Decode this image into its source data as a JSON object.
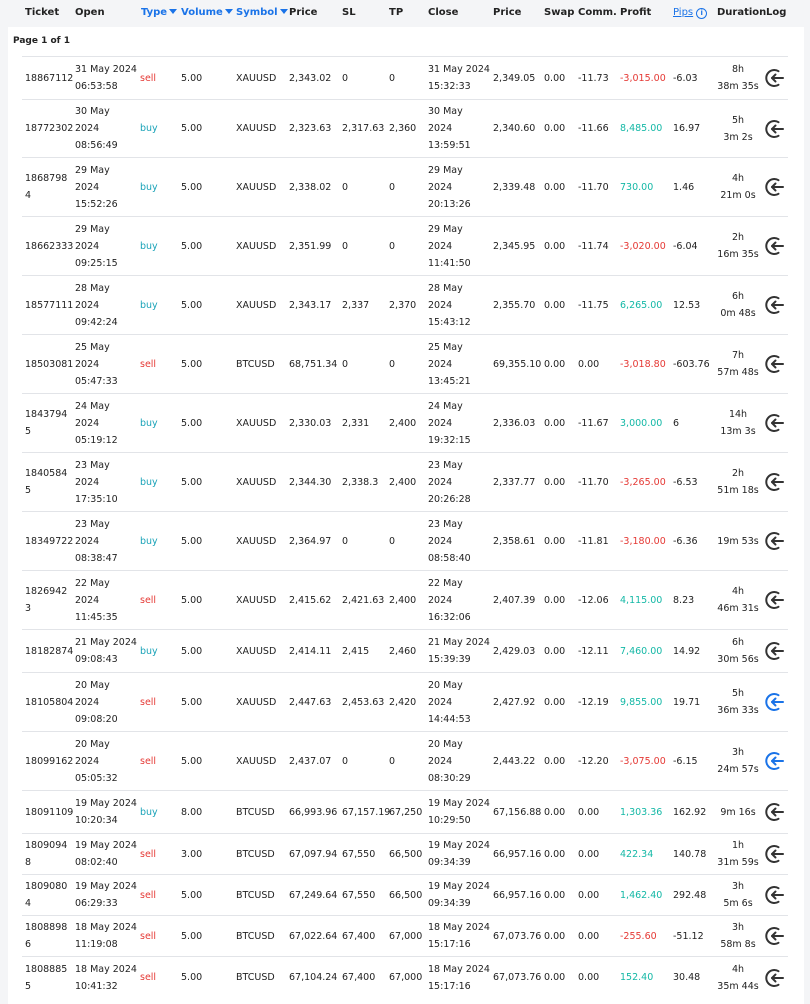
{
  "columns": {
    "ticket": "Ticket",
    "open": "Open",
    "type": "Type",
    "volume": "Volume",
    "symbol": "Symbol",
    "price": "Price",
    "sl": "SL",
    "tp": "TP",
    "close": "Close",
    "close_price": "Price",
    "swap": "Swap",
    "comm": "Comm.",
    "profit": "Profit",
    "pips": "Pips",
    "duration": "Duration",
    "log": "Log"
  },
  "page_info": "Page 1 of 1",
  "colors": {
    "sell": "#e53935",
    "buy": "#1aa3b8",
    "profit_pos": "#14b8a6",
    "profit_neg": "#e53935",
    "link": "#1a73e8"
  },
  "rows": [
    {
      "ticket": [
        "18867112"
      ],
      "open": [
        "31 May 2024",
        "06:53:58"
      ],
      "type": "sell",
      "volume": "5.00",
      "symbol": "XAUUSD",
      "price": "2,343.02",
      "sl": "0",
      "tp": "0",
      "close": [
        "31 May 2024",
        "15:32:33"
      ],
      "close_price": "2,349.05",
      "swap": "0.00",
      "comm": "-11.73",
      "profit": "-3,015.00",
      "pips": "-6.03",
      "duration": [
        "8h",
        "38m 35s"
      ],
      "log_active": false
    },
    {
      "ticket": [
        "18772302"
      ],
      "open": [
        "30 May",
        "2024",
        "08:56:49"
      ],
      "type": "buy",
      "volume": "5.00",
      "symbol": "XAUUSD",
      "price": "2,323.63",
      "sl": "2,317.63",
      "tp": "2,360",
      "close": [
        "30 May",
        "2024",
        "13:59:51"
      ],
      "close_price": "2,340.60",
      "swap": "0.00",
      "comm": "-11.66",
      "profit": "8,485.00",
      "pips": "16.97",
      "duration": [
        "5h",
        "3m 2s"
      ],
      "log_active": false
    },
    {
      "ticket": [
        "1868798",
        "4"
      ],
      "open": [
        "29 May",
        "2024",
        "15:52:26"
      ],
      "type": "buy",
      "volume": "5.00",
      "symbol": "XAUUSD",
      "price": "2,338.02",
      "sl": "0",
      "tp": "0",
      "close": [
        "29 May",
        "2024",
        "20:13:26"
      ],
      "close_price": "2,339.48",
      "swap": "0.00",
      "comm": "-11.70",
      "profit": "730.00",
      "pips": "1.46",
      "duration": [
        "4h",
        "21m 0s"
      ],
      "log_active": false
    },
    {
      "ticket": [
        "18662333"
      ],
      "open": [
        "29 May",
        "2024",
        "09:25:15"
      ],
      "type": "buy",
      "volume": "5.00",
      "symbol": "XAUUSD",
      "price": "2,351.99",
      "sl": "0",
      "tp": "0",
      "close": [
        "29 May",
        "2024",
        "11:41:50"
      ],
      "close_price": "2,345.95",
      "swap": "0.00",
      "comm": "-11.74",
      "profit": "-3,020.00",
      "pips": "-6.04",
      "duration": [
        "2h",
        "16m 35s"
      ],
      "log_active": false
    },
    {
      "ticket": [
        "18577111"
      ],
      "open": [
        "28 May",
        "2024",
        "09:42:24"
      ],
      "type": "buy",
      "volume": "5.00",
      "symbol": "XAUUSD",
      "price": "2,343.17",
      "sl": "2,337",
      "tp": "2,370",
      "close": [
        "28 May",
        "2024",
        "15:43:12"
      ],
      "close_price": "2,355.70",
      "swap": "0.00",
      "comm": "-11.75",
      "profit": "6,265.00",
      "pips": "12.53",
      "duration": [
        "6h",
        "0m 48s"
      ],
      "log_active": false
    },
    {
      "ticket": [
        "18503081"
      ],
      "open": [
        "25 May",
        "2024",
        "05:47:33"
      ],
      "type": "sell",
      "volume": "5.00",
      "symbol": "BTCUSD",
      "price": "68,751.34",
      "sl": "0",
      "tp": "0",
      "close": [
        "25 May",
        "2024",
        "13:45:21"
      ],
      "close_price": "69,355.10",
      "swap": "0.00",
      "comm": "0.00",
      "profit": "-3,018.80",
      "pips": "-603.76",
      "duration": [
        "7h",
        "57m 48s"
      ],
      "log_active": false
    },
    {
      "ticket": [
        "1843794",
        "5"
      ],
      "open": [
        "24 May",
        "2024",
        "05:19:12"
      ],
      "type": "buy",
      "volume": "5.00",
      "symbol": "XAUUSD",
      "price": "2,330.03",
      "sl": "2,331",
      "tp": "2,400",
      "close": [
        "24 May",
        "2024",
        "19:32:15"
      ],
      "close_price": "2,336.03",
      "swap": "0.00",
      "comm": "-11.67",
      "profit": "3,000.00",
      "pips": "6",
      "duration": [
        "14h",
        "13m 3s"
      ],
      "log_active": false
    },
    {
      "ticket": [
        "1840584",
        "5"
      ],
      "open": [
        "23 May",
        "2024",
        "17:35:10"
      ],
      "type": "buy",
      "volume": "5.00",
      "symbol": "XAUUSD",
      "price": "2,344.30",
      "sl": "2,338.3",
      "tp": "2,400",
      "close": [
        "23 May",
        "2024",
        "20:26:28"
      ],
      "close_price": "2,337.77",
      "swap": "0.00",
      "comm": "-11.70",
      "profit": "-3,265.00",
      "pips": "-6.53",
      "duration": [
        "2h",
        "51m 18s"
      ],
      "log_active": false
    },
    {
      "ticket": [
        "18349722"
      ],
      "open": [
        "23 May",
        "2024",
        "08:38:47"
      ],
      "type": "buy",
      "volume": "5.00",
      "symbol": "XAUUSD",
      "price": "2,364.97",
      "sl": "0",
      "tp": "0",
      "close": [
        "23 May",
        "2024",
        "08:58:40"
      ],
      "close_price": "2,358.61",
      "swap": "0.00",
      "comm": "-11.81",
      "profit": "-3,180.00",
      "pips": "-6.36",
      "duration": [
        "19m 53s"
      ],
      "log_active": false
    },
    {
      "ticket": [
        "1826942",
        "3"
      ],
      "open": [
        "22 May",
        "2024",
        "11:45:35"
      ],
      "type": "sell",
      "volume": "5.00",
      "symbol": "XAUUSD",
      "price": "2,415.62",
      "sl": "2,421.63",
      "tp": "2,400",
      "close": [
        "22 May",
        "2024",
        "16:32:06"
      ],
      "close_price": "2,407.39",
      "swap": "0.00",
      "comm": "-12.06",
      "profit": "4,115.00",
      "pips": "8.23",
      "duration": [
        "4h",
        "46m 31s"
      ],
      "log_active": false
    },
    {
      "ticket": [
        "18182874"
      ],
      "open": [
        "21 May 2024",
        "09:08:43"
      ],
      "type": "buy",
      "volume": "5.00",
      "symbol": "XAUUSD",
      "price": "2,414.11",
      "sl": "2,415",
      "tp": "2,460",
      "close": [
        "21 May 2024",
        "15:39:39"
      ],
      "close_price": "2,429.03",
      "swap": "0.00",
      "comm": "-12.11",
      "profit": "7,460.00",
      "pips": "14.92",
      "duration": [
        "6h",
        "30m 56s"
      ],
      "log_active": false
    },
    {
      "ticket": [
        "18105804"
      ],
      "open": [
        "20 May",
        "2024",
        "09:08:20"
      ],
      "type": "sell",
      "volume": "5.00",
      "symbol": "XAUUSD",
      "price": "2,447.63",
      "sl": "2,453.63",
      "tp": "2,420",
      "close": [
        "20 May",
        "2024",
        "14:44:53"
      ],
      "close_price": "2,427.92",
      "swap": "0.00",
      "comm": "-12.19",
      "profit": "9,855.00",
      "pips": "19.71",
      "duration": [
        "5h",
        "36m 33s"
      ],
      "log_active": true
    },
    {
      "ticket": [
        "18099162"
      ],
      "open": [
        "20 May",
        "2024",
        "05:05:32"
      ],
      "type": "sell",
      "volume": "5.00",
      "symbol": "XAUUSD",
      "price": "2,437.07",
      "sl": "0",
      "tp": "0",
      "close": [
        "20 May",
        "2024",
        "08:30:29"
      ],
      "close_price": "2,443.22",
      "swap": "0.00",
      "comm": "-12.20",
      "profit": "-3,075.00",
      "pips": "-6.15",
      "duration": [
        "3h",
        "24m 57s"
      ],
      "log_active": true
    },
    {
      "ticket": [
        "18091109"
      ],
      "open": [
        "19 May 2024",
        "10:20:34"
      ],
      "type": "buy",
      "volume": "8.00",
      "symbol": "BTCUSD",
      "price": "66,993.96",
      "sl": "67,157.19",
      "tp": "67,250",
      "close": [
        "19 May 2024",
        "10:29:50"
      ],
      "close_price": "67,156.88",
      "swap": "0.00",
      "comm": "0.00",
      "profit": "1,303.36",
      "pips": "162.92",
      "duration": [
        "9m 16s"
      ],
      "log_active": false
    },
    {
      "ticket": [
        "1809094",
        "8"
      ],
      "open": [
        "19 May 2024",
        "08:02:40"
      ],
      "type": "sell",
      "volume": "3.00",
      "symbol": "BTCUSD",
      "price": "67,097.94",
      "sl": "67,550",
      "tp": "66,500",
      "close": [
        "19 May 2024",
        "09:34:39"
      ],
      "close_price": "66,957.16",
      "swap": "0.00",
      "comm": "0.00",
      "profit": "422.34",
      "pips": "140.78",
      "duration": [
        "1h",
        "31m 59s"
      ],
      "log_active": false
    },
    {
      "ticket": [
        "1809080",
        "4"
      ],
      "open": [
        "19 May 2024",
        "06:29:33"
      ],
      "type": "sell",
      "volume": "5.00",
      "symbol": "BTCUSD",
      "price": "67,249.64",
      "sl": "67,550",
      "tp": "66,500",
      "close": [
        "19 May 2024",
        "09:34:39"
      ],
      "close_price": "66,957.16",
      "swap": "0.00",
      "comm": "0.00",
      "profit": "1,462.40",
      "pips": "292.48",
      "duration": [
        "3h",
        "5m 6s"
      ],
      "log_active": false
    },
    {
      "ticket": [
        "1808898",
        "6"
      ],
      "open": [
        "18 May 2024",
        "11:19:08"
      ],
      "type": "sell",
      "volume": "5.00",
      "symbol": "BTCUSD",
      "price": "67,022.64",
      "sl": "67,400",
      "tp": "67,000",
      "close": [
        "18 May 2024",
        "15:17:16"
      ],
      "close_price": "67,073.76",
      "swap": "0.00",
      "comm": "0.00",
      "profit": "-255.60",
      "pips": "-51.12",
      "duration": [
        "3h",
        "58m 8s"
      ],
      "log_active": false
    },
    {
      "ticket": [
        "1808885",
        "5"
      ],
      "open": [
        "18 May 2024",
        "10:41:32"
      ],
      "type": "sell",
      "volume": "5.00",
      "symbol": "BTCUSD",
      "price": "67,104.24",
      "sl": "67,400",
      "tp": "67,000",
      "close": [
        "18 May 2024",
        "15:17:16"
      ],
      "close_price": "67,073.76",
      "swap": "0.00",
      "comm": "0.00",
      "profit": "152.40",
      "pips": "30.48",
      "duration": [
        "4h",
        "35m 44s"
      ],
      "log_active": false
    }
  ]
}
